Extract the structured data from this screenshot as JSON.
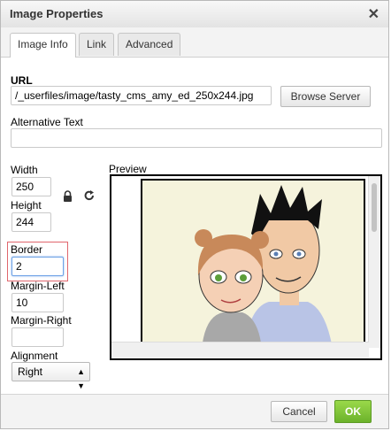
{
  "dialog": {
    "title": "Image Properties",
    "close_glyph": "✕"
  },
  "tabs": [
    {
      "label": "Image Info"
    },
    {
      "label": "Link"
    },
    {
      "label": "Advanced"
    }
  ],
  "url": {
    "label": "URL",
    "value": "/_userfiles/image/tasty_cms_amy_ed_250x244.jpg",
    "browse_label": "Browse Server"
  },
  "alt_text": {
    "label": "Alternative Text",
    "value": ""
  },
  "width": {
    "label": "Width",
    "value": "250"
  },
  "height": {
    "label": "Height",
    "value": "244"
  },
  "border": {
    "label": "Border",
    "value": "2"
  },
  "margin_left": {
    "label": "Margin-Left",
    "value": "10"
  },
  "margin_right": {
    "label": "Margin-Right",
    "value": ""
  },
  "alignment": {
    "label": "Alignment",
    "selected": "Right"
  },
  "preview": {
    "label": "Preview"
  },
  "footer": {
    "cancel_label": "Cancel",
    "ok_label": "OK"
  },
  "colors": {
    "ok_button": "#6bb22b",
    "focus_outline": "#e0666d",
    "preview_bg": "#f5f3dc"
  },
  "icons": {
    "lock": "lock-icon",
    "reset": "reset-size-icon",
    "close": "close-icon",
    "dropdown": "dropdown-arrow-icon"
  }
}
